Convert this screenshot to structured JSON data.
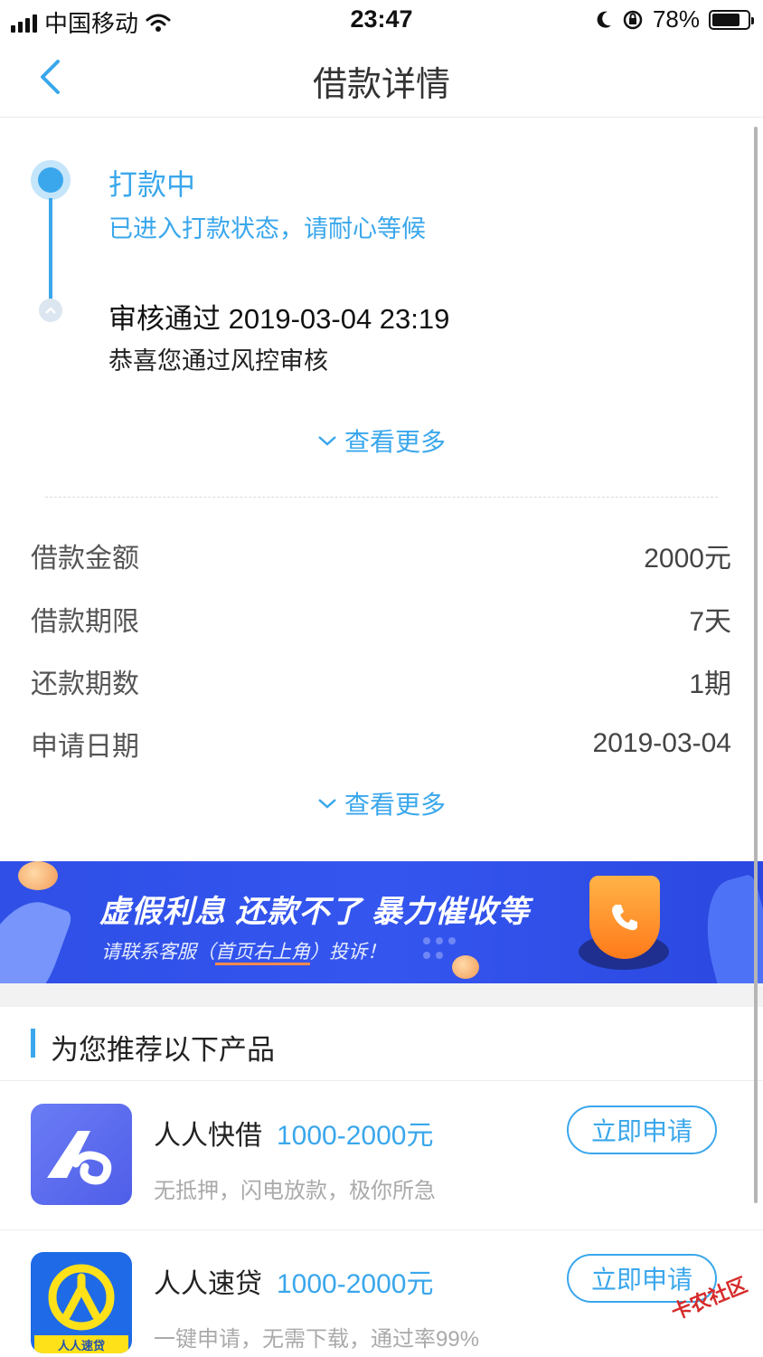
{
  "status_bar": {
    "carrier": "中国移动",
    "time": "23:47",
    "battery": "78%",
    "battery_level": 0.78,
    "icons": [
      "signal-icon",
      "wifi-icon",
      "moon-icon",
      "rotation-lock-icon",
      "battery-icon"
    ]
  },
  "nav": {
    "title": "借款详情",
    "back_icon": "chevron-left-icon"
  },
  "timeline": {
    "step1_title": "打款中",
    "step1_desc": "已进入打款状态，请耐心等候",
    "step2_title": "审核通过 2019-03-04 23:19",
    "step2_desc": "恭喜您通过风控审核",
    "more": "查看更多"
  },
  "details": {
    "rows": [
      {
        "label": "借款金额",
        "value": "2000元"
      },
      {
        "label": "借款期限",
        "value": "7天"
      },
      {
        "label": "还款期数",
        "value": "1期"
      },
      {
        "label": "申请日期",
        "value": "2019-03-04"
      }
    ],
    "more": "查看更多"
  },
  "banner": {
    "headline": "虚假利息  还款不了  暴力催收等",
    "sub_prefix": "请联系客服（",
    "sub_highlight": "首页右上角",
    "sub_suffix": "）投诉！"
  },
  "recommend": {
    "title": "为您推荐以下产品",
    "products": [
      {
        "name": "人人快借",
        "range": "1000-2000元",
        "desc": "无抵押，闪电放款，极你所急",
        "button": "立即申请"
      },
      {
        "name": "人人速贷",
        "range": "1000-2000元",
        "desc": "一键申请，无需下载，通过率99%",
        "button": "立即申请",
        "logo_text": "人人速贷"
      }
    ]
  },
  "watermark": "卡农社区",
  "colors": {
    "accent": "#3aa7ec",
    "banner": "#3456ef",
    "logo1": "#5b6cf0",
    "logo2": "#1f6ae6"
  }
}
